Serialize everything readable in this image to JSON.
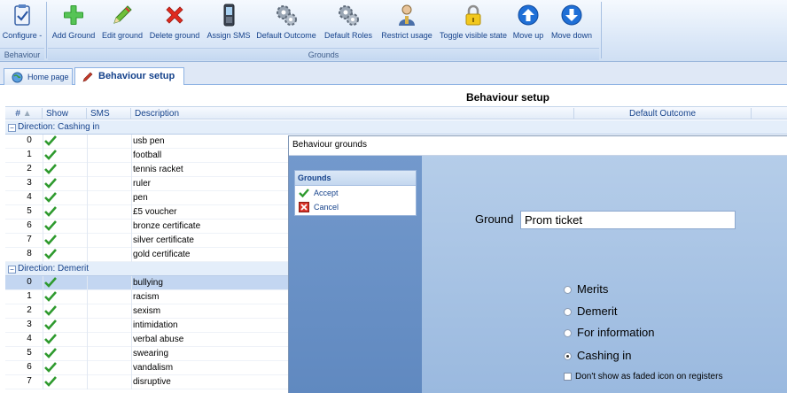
{
  "ribbon": {
    "configure_label": "Configure -",
    "behaviour_group": "Behaviour",
    "grounds_group": "Grounds",
    "buttons": {
      "add": "Add Ground",
      "edit": "Edit ground",
      "delete": "Delete ground",
      "sms": "Assign SMS",
      "outcome": "Default Outcome",
      "roles": "Default Roles",
      "restrict": "Restrict usage",
      "toggle": "Toggle visible state",
      "up": "Move up",
      "down": "Move down"
    }
  },
  "tabs": {
    "home": "Home page",
    "behaviour": "Behaviour setup"
  },
  "page": {
    "title": "Behaviour setup"
  },
  "grid": {
    "columns": {
      "num": "#",
      "show": "Show",
      "sms": "SMS",
      "description": "Description",
      "outcome": "Default Outcome"
    },
    "groups": [
      {
        "label": "Direction: Cashing in",
        "rows": [
          {
            "n": "0",
            "desc": "usb pen"
          },
          {
            "n": "1",
            "desc": "football"
          },
          {
            "n": "2",
            "desc": "tennis racket"
          },
          {
            "n": "3",
            "desc": "ruler"
          },
          {
            "n": "4",
            "desc": "pen"
          },
          {
            "n": "5",
            "desc": "£5 voucher"
          },
          {
            "n": "6",
            "desc": "bronze certificate"
          },
          {
            "n": "7",
            "desc": "silver certificate"
          },
          {
            "n": "8",
            "desc": "gold certificate"
          }
        ]
      },
      {
        "label": "Direction: Demerit",
        "rows": [
          {
            "n": "0",
            "desc": "bullying"
          },
          {
            "n": "1",
            "desc": "racism"
          },
          {
            "n": "2",
            "desc": "sexism"
          },
          {
            "n": "3",
            "desc": "intimidation"
          },
          {
            "n": "4",
            "desc": "verbal abuse"
          },
          {
            "n": "5",
            "desc": "swearing"
          },
          {
            "n": "6",
            "desc": "vandalism"
          },
          {
            "n": "7",
            "desc": "disruptive"
          }
        ]
      }
    ]
  },
  "dialog": {
    "title": "Behaviour grounds",
    "panel_title": "Grounds",
    "accept": "Accept",
    "cancel": "Cancel",
    "ground_label": "Ground",
    "ground_value": "Prom ticket",
    "options": {
      "merits": "Merits",
      "demerit": "Demerit",
      "info": "For information",
      "cashing": "Cashing in"
    },
    "selected_option": "Cashing in",
    "faded_label": "Don't show as faded icon on registers",
    "faded_checked": false
  }
}
